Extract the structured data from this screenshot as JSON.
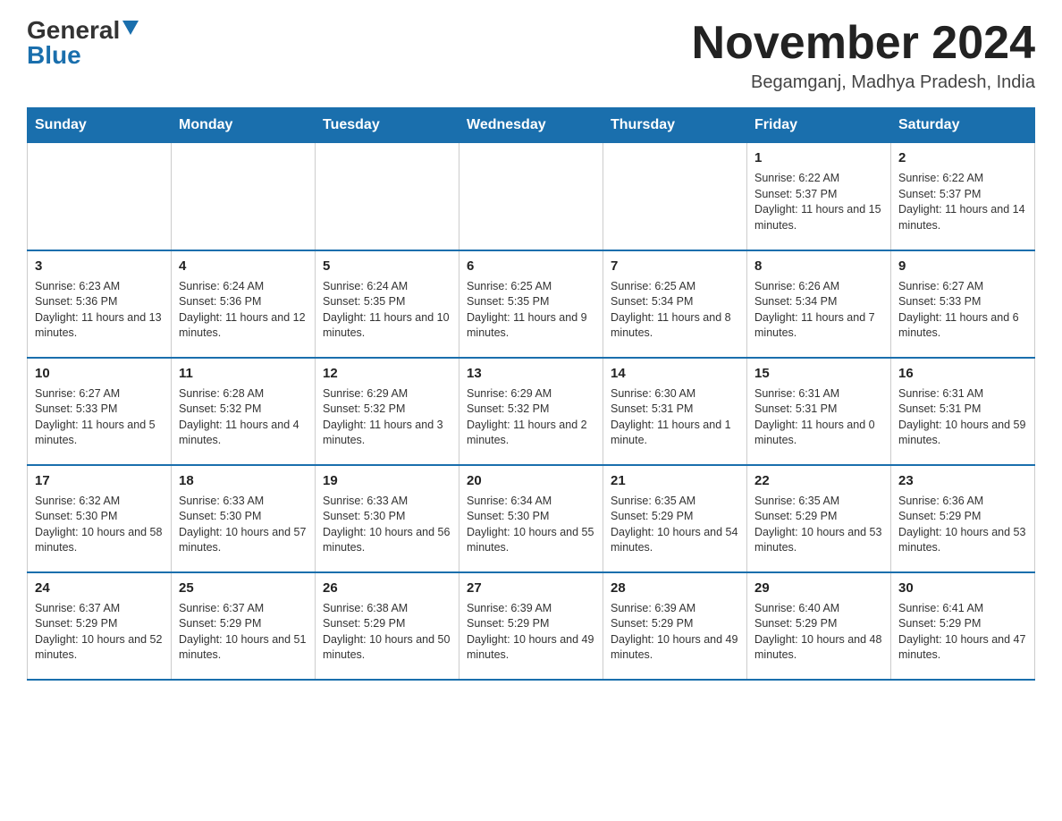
{
  "header": {
    "logo_general": "General",
    "logo_blue": "Blue",
    "month_year": "November 2024",
    "location": "Begamganj, Madhya Pradesh, India"
  },
  "days_of_week": [
    "Sunday",
    "Monday",
    "Tuesday",
    "Wednesday",
    "Thursday",
    "Friday",
    "Saturday"
  ],
  "weeks": [
    [
      {
        "day": "",
        "info": ""
      },
      {
        "day": "",
        "info": ""
      },
      {
        "day": "",
        "info": ""
      },
      {
        "day": "",
        "info": ""
      },
      {
        "day": "",
        "info": ""
      },
      {
        "day": "1",
        "info": "Sunrise: 6:22 AM\nSunset: 5:37 PM\nDaylight: 11 hours and 15 minutes."
      },
      {
        "day": "2",
        "info": "Sunrise: 6:22 AM\nSunset: 5:37 PM\nDaylight: 11 hours and 14 minutes."
      }
    ],
    [
      {
        "day": "3",
        "info": "Sunrise: 6:23 AM\nSunset: 5:36 PM\nDaylight: 11 hours and 13 minutes."
      },
      {
        "day": "4",
        "info": "Sunrise: 6:24 AM\nSunset: 5:36 PM\nDaylight: 11 hours and 12 minutes."
      },
      {
        "day": "5",
        "info": "Sunrise: 6:24 AM\nSunset: 5:35 PM\nDaylight: 11 hours and 10 minutes."
      },
      {
        "day": "6",
        "info": "Sunrise: 6:25 AM\nSunset: 5:35 PM\nDaylight: 11 hours and 9 minutes."
      },
      {
        "day": "7",
        "info": "Sunrise: 6:25 AM\nSunset: 5:34 PM\nDaylight: 11 hours and 8 minutes."
      },
      {
        "day": "8",
        "info": "Sunrise: 6:26 AM\nSunset: 5:34 PM\nDaylight: 11 hours and 7 minutes."
      },
      {
        "day": "9",
        "info": "Sunrise: 6:27 AM\nSunset: 5:33 PM\nDaylight: 11 hours and 6 minutes."
      }
    ],
    [
      {
        "day": "10",
        "info": "Sunrise: 6:27 AM\nSunset: 5:33 PM\nDaylight: 11 hours and 5 minutes."
      },
      {
        "day": "11",
        "info": "Sunrise: 6:28 AM\nSunset: 5:32 PM\nDaylight: 11 hours and 4 minutes."
      },
      {
        "day": "12",
        "info": "Sunrise: 6:29 AM\nSunset: 5:32 PM\nDaylight: 11 hours and 3 minutes."
      },
      {
        "day": "13",
        "info": "Sunrise: 6:29 AM\nSunset: 5:32 PM\nDaylight: 11 hours and 2 minutes."
      },
      {
        "day": "14",
        "info": "Sunrise: 6:30 AM\nSunset: 5:31 PM\nDaylight: 11 hours and 1 minute."
      },
      {
        "day": "15",
        "info": "Sunrise: 6:31 AM\nSunset: 5:31 PM\nDaylight: 11 hours and 0 minutes."
      },
      {
        "day": "16",
        "info": "Sunrise: 6:31 AM\nSunset: 5:31 PM\nDaylight: 10 hours and 59 minutes."
      }
    ],
    [
      {
        "day": "17",
        "info": "Sunrise: 6:32 AM\nSunset: 5:30 PM\nDaylight: 10 hours and 58 minutes."
      },
      {
        "day": "18",
        "info": "Sunrise: 6:33 AM\nSunset: 5:30 PM\nDaylight: 10 hours and 57 minutes."
      },
      {
        "day": "19",
        "info": "Sunrise: 6:33 AM\nSunset: 5:30 PM\nDaylight: 10 hours and 56 minutes."
      },
      {
        "day": "20",
        "info": "Sunrise: 6:34 AM\nSunset: 5:30 PM\nDaylight: 10 hours and 55 minutes."
      },
      {
        "day": "21",
        "info": "Sunrise: 6:35 AM\nSunset: 5:29 PM\nDaylight: 10 hours and 54 minutes."
      },
      {
        "day": "22",
        "info": "Sunrise: 6:35 AM\nSunset: 5:29 PM\nDaylight: 10 hours and 53 minutes."
      },
      {
        "day": "23",
        "info": "Sunrise: 6:36 AM\nSunset: 5:29 PM\nDaylight: 10 hours and 53 minutes."
      }
    ],
    [
      {
        "day": "24",
        "info": "Sunrise: 6:37 AM\nSunset: 5:29 PM\nDaylight: 10 hours and 52 minutes."
      },
      {
        "day": "25",
        "info": "Sunrise: 6:37 AM\nSunset: 5:29 PM\nDaylight: 10 hours and 51 minutes."
      },
      {
        "day": "26",
        "info": "Sunrise: 6:38 AM\nSunset: 5:29 PM\nDaylight: 10 hours and 50 minutes."
      },
      {
        "day": "27",
        "info": "Sunrise: 6:39 AM\nSunset: 5:29 PM\nDaylight: 10 hours and 49 minutes."
      },
      {
        "day": "28",
        "info": "Sunrise: 6:39 AM\nSunset: 5:29 PM\nDaylight: 10 hours and 49 minutes."
      },
      {
        "day": "29",
        "info": "Sunrise: 6:40 AM\nSunset: 5:29 PM\nDaylight: 10 hours and 48 minutes."
      },
      {
        "day": "30",
        "info": "Sunrise: 6:41 AM\nSunset: 5:29 PM\nDaylight: 10 hours and 47 minutes."
      }
    ]
  ]
}
